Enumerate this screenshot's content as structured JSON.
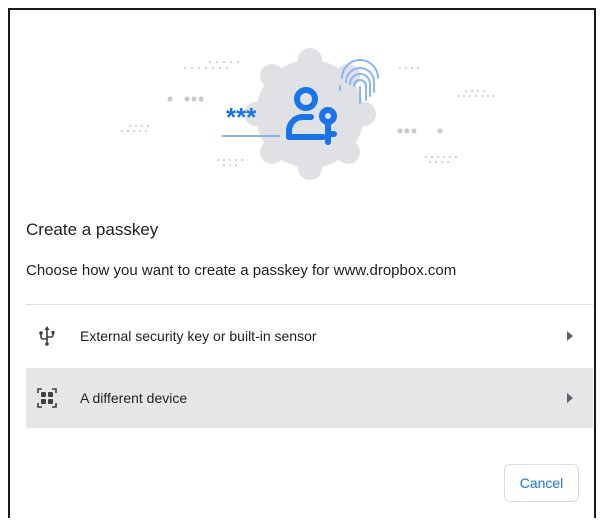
{
  "dialog": {
    "title": "Create a passkey",
    "subtitle": "Choose how you want to create a passkey for www.dropbox.com",
    "illustration": {
      "icon": "person-key-icon",
      "password_mask": "***",
      "accent_color": "#1a73e8",
      "badge_color": "#dfe1e5"
    },
    "options": [
      {
        "label": "External security key or built-in sensor",
        "icon": "usb-icon",
        "selected": false
      },
      {
        "label": "A different device",
        "icon": "qr-code-icon",
        "selected": true
      }
    ],
    "cancel_label": "Cancel"
  }
}
